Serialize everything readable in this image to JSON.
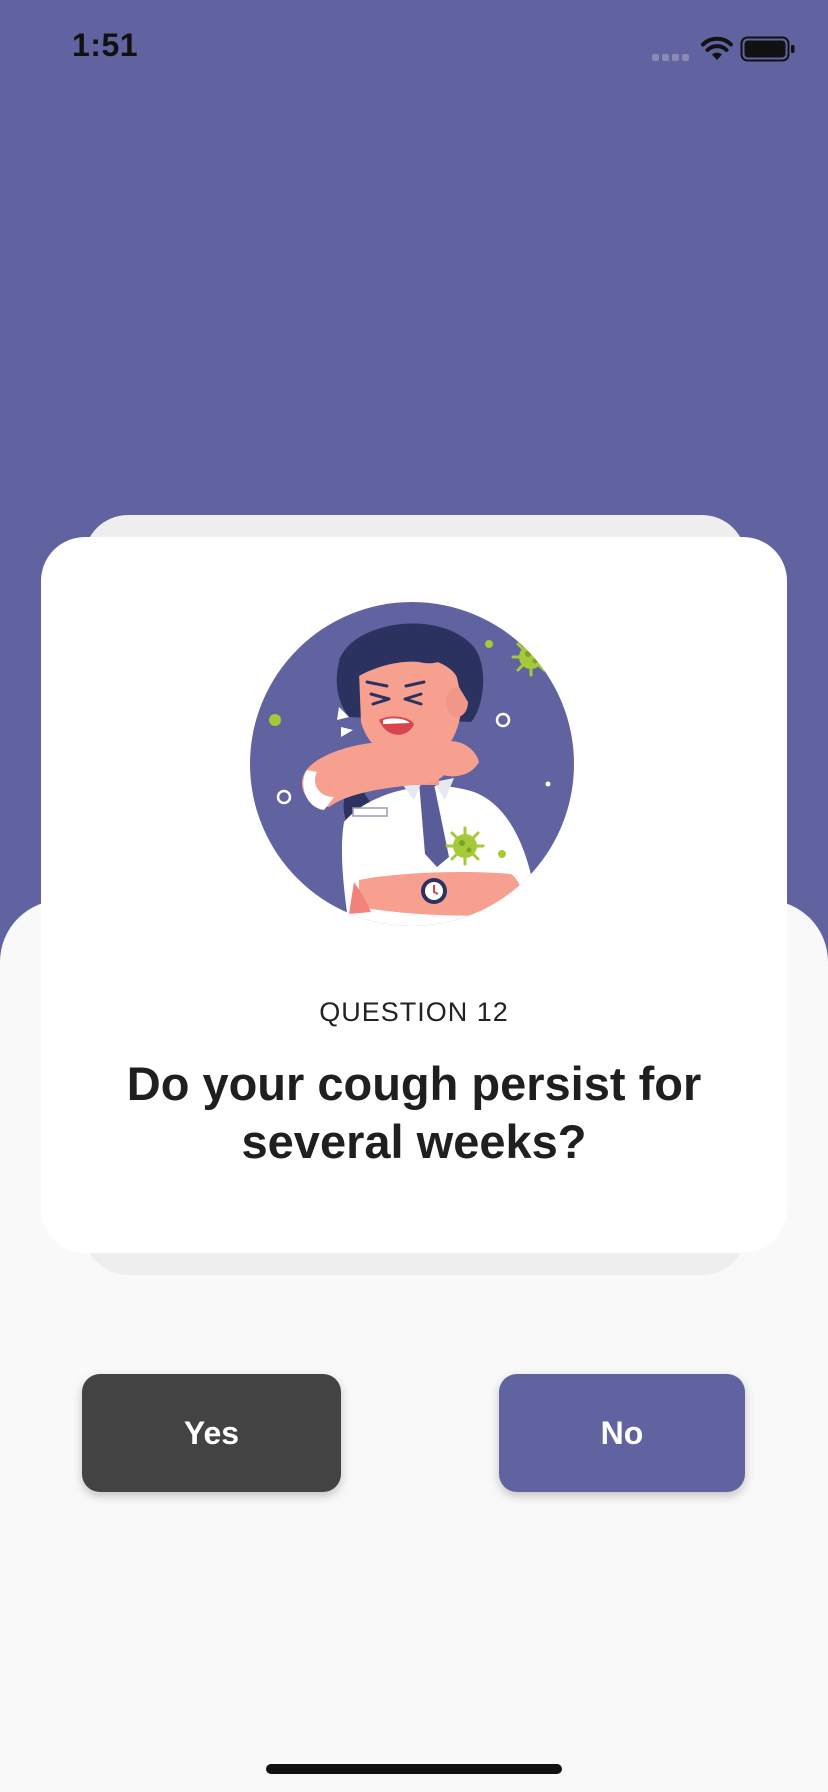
{
  "status_bar": {
    "time": "1:51",
    "icons": [
      "cellular-signal-icon",
      "wifi-icon",
      "battery-icon"
    ]
  },
  "question": {
    "label": "QUESTION 12",
    "text": "Do your cough persist for several weeks?",
    "illustration": "person-coughing-into-elbow-illustration"
  },
  "buttons": {
    "yes_label": "Yes",
    "no_label": "No"
  },
  "colors": {
    "primary": "#6163a1",
    "yes_button": "#434343",
    "background": "#f9f9f9",
    "card": "#ffffff",
    "virus": "#a6c93a"
  }
}
